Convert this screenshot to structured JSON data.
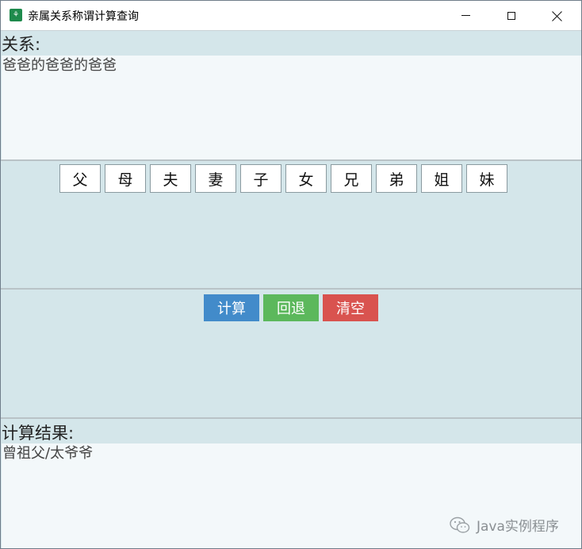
{
  "window": {
    "title": "亲属关系称谓计算查询",
    "icon": "family-tree-app-icon"
  },
  "relation": {
    "label": "关系:",
    "value": "爸爸的爸爸的爸爸"
  },
  "kin_buttons": [
    "父",
    "母",
    "夫",
    "妻",
    "子",
    "女",
    "兄",
    "弟",
    "姐",
    "妹"
  ],
  "actions": {
    "calculate": {
      "label": "计算",
      "color": "#428bca"
    },
    "back": {
      "label": "回退",
      "color": "#5cb85c"
    },
    "clear": {
      "label": "清空",
      "color": "#d9534f"
    }
  },
  "result": {
    "label": "计算结果:",
    "value": "曾祖父/太爷爷"
  },
  "watermark": {
    "text": "Java实例程序",
    "icon": "wechat-icon"
  },
  "colors": {
    "panel_bg": "#d4e6ea",
    "textarea_bg": "#f3f8fa"
  }
}
